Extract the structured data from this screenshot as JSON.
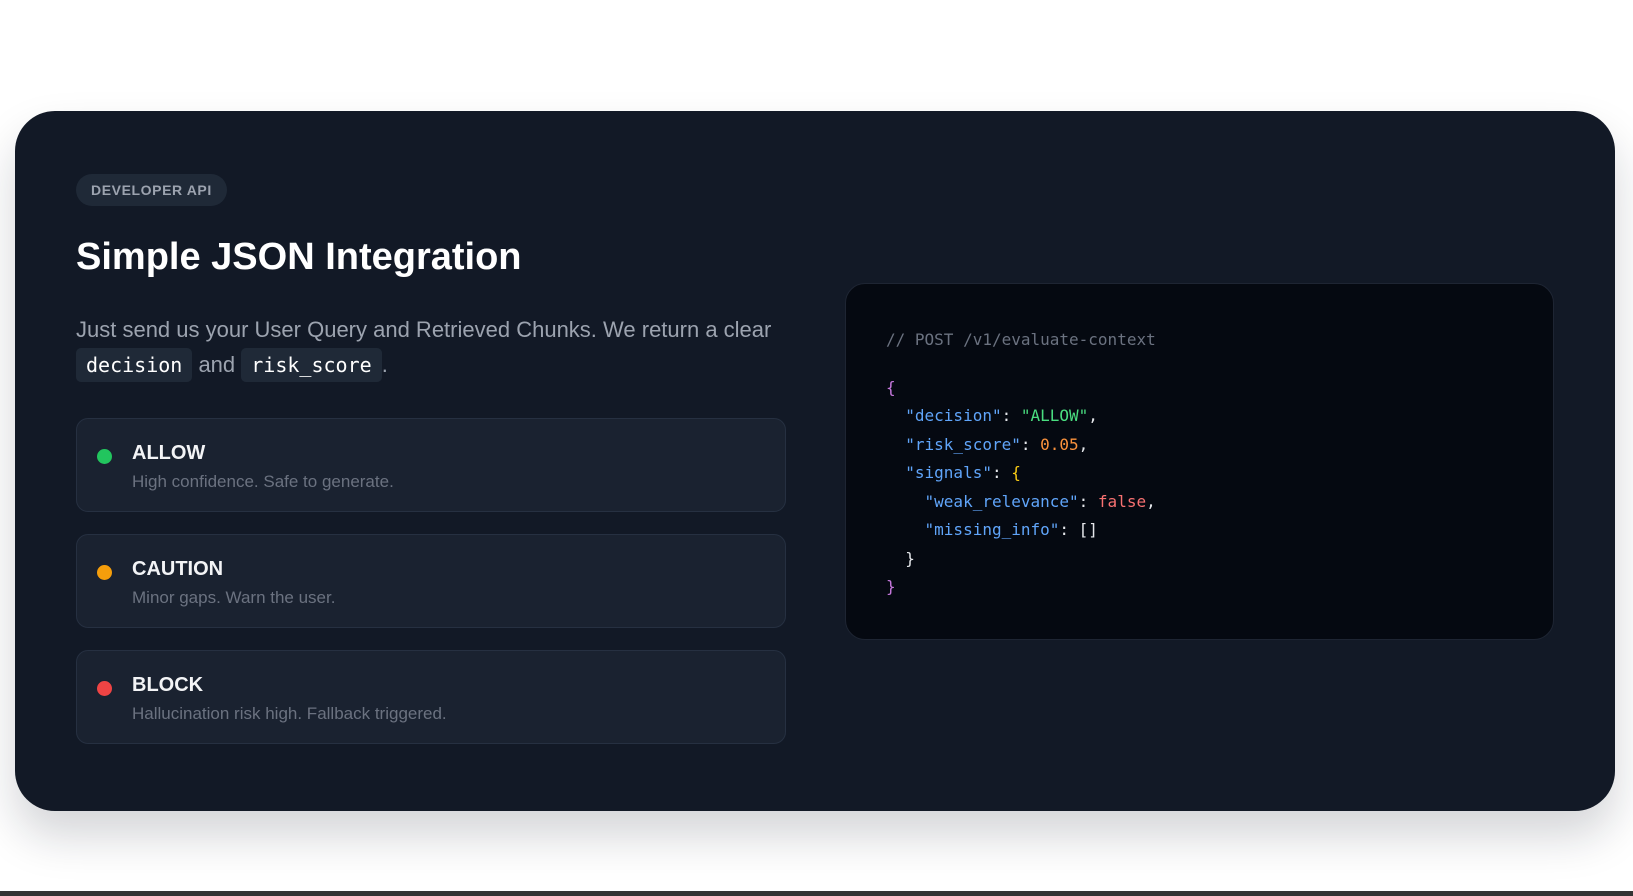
{
  "badge": "DEVELOPER API",
  "title": "Simple JSON Integration",
  "description": {
    "part1": "Just send us your User Query and Retrieved Chunks. We return a clear ",
    "code1": "decision",
    "part2": " and ",
    "code2": "risk_score",
    "part3": "."
  },
  "statuses": [
    {
      "label": "ALLOW",
      "description": "High confidence. Safe to generate.",
      "color": "#22c55e"
    },
    {
      "label": "CAUTION",
      "description": "Minor gaps. Warn the user.",
      "color": "#f59e0b"
    },
    {
      "label": "BLOCK",
      "description": "Hallucination risk high. Fallback triggered.",
      "color": "#ef4444"
    }
  ],
  "code": {
    "comment": "// POST /v1/evaluate-context",
    "open_brace": "{",
    "close_brace": "}",
    "decision_key": "\"decision\"",
    "decision_value": "\"ALLOW\"",
    "risk_key": "\"risk_score\"",
    "risk_value": "0.05",
    "signals_key": "\"signals\"",
    "weak_key": "\"weak_relevance\"",
    "weak_value": "false",
    "missing_key": "\"missing_info\"",
    "missing_value": "[]"
  },
  "colors": {
    "card_bg": "#121926",
    "code_bg": "#050911",
    "allow": "#22c55e",
    "caution": "#f59e0b",
    "block": "#ef4444"
  }
}
